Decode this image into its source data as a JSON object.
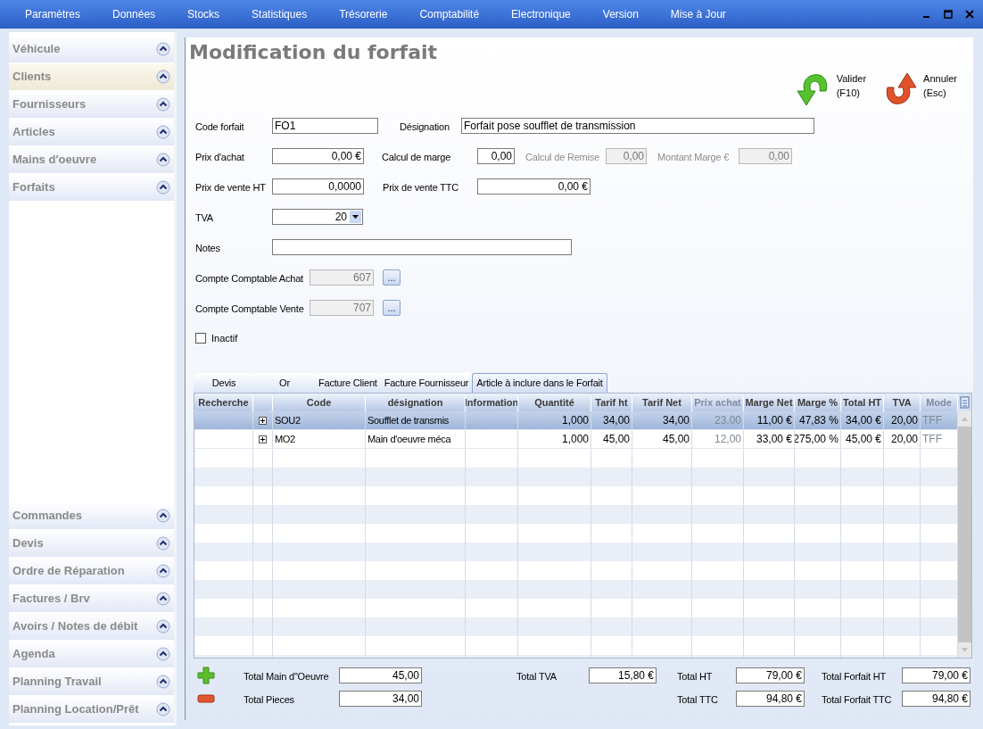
{
  "menu": [
    {
      "label": "Paramètres"
    },
    {
      "label": "Données"
    },
    {
      "label": "Stocks"
    },
    {
      "label": "Statistiques"
    },
    {
      "label": "Trésorerie"
    },
    {
      "label": "Comptabilité"
    },
    {
      "label": "Electronique"
    },
    {
      "label": "Version"
    },
    {
      "label": "Mise à Jour"
    }
  ],
  "sidebar": {
    "top": [
      {
        "label": "Véhicule",
        "selected": false
      },
      {
        "label": "Clients",
        "selected": true
      },
      {
        "label": "Fournisseurs",
        "selected": false
      },
      {
        "label": "Articles",
        "selected": false
      },
      {
        "label": "Mains d'oeuvre",
        "selected": false
      },
      {
        "label": "Forfaits",
        "selected": false
      }
    ],
    "bottom": [
      {
        "label": "Commandes",
        "selected": false
      },
      {
        "label": "Devis",
        "selected": false
      },
      {
        "label": "Ordre de Réparation",
        "selected": false
      },
      {
        "label": "Factures / Brv",
        "selected": false
      },
      {
        "label": "Avoirs / Notes de débit",
        "selected": false
      },
      {
        "label": "Agenda",
        "selected": false
      },
      {
        "label": "Planning Travail",
        "selected": false
      },
      {
        "label": "Planning Location/Prêt",
        "selected": false
      }
    ]
  },
  "title": "Modification du forfait",
  "actions": [
    {
      "kind": "ok",
      "label": "Valider",
      "key": "(F10)"
    },
    {
      "kind": "cancel",
      "label": "Annuler",
      "key": "(Esc)"
    }
  ],
  "form": [
    [
      {
        "kind": "label",
        "text": "Code forfait",
        "disabled": false
      },
      {
        "kind": "text_input",
        "value": "FO1",
        "disabled": false
      },
      {
        "kind": "label",
        "text": "Désignation",
        "disabled": false
      },
      {
        "kind": "text_input",
        "value": "Forfait pose soufflet de transmission",
        "disabled": false
      }
    ],
    [
      {
        "kind": "label",
        "text": "Prix d'achat",
        "disabled": false
      },
      {
        "kind": "number_input",
        "value": "0,00 €",
        "disabled": false
      },
      {
        "kind": "label",
        "text": "Calcul de marge",
        "disabled": false
      },
      {
        "kind": "number_input",
        "value": "0,00",
        "disabled": false
      },
      {
        "kind": "label",
        "text": "Calcul de Remise",
        "disabled": true
      },
      {
        "kind": "number_input",
        "value": "0,00",
        "disabled": true
      },
      {
        "kind": "label",
        "text": "Montant Marge €",
        "disabled": true
      },
      {
        "kind": "number_input",
        "value": "0,00",
        "disabled": true
      }
    ],
    [
      {
        "kind": "label",
        "text": "Prix de vente HT",
        "disabled": false
      },
      {
        "kind": "number_input",
        "value": "0,0000",
        "disabled": false
      },
      {
        "kind": "label",
        "text": "Prix de vente TTC",
        "disabled": false
      },
      {
        "kind": "number_input",
        "value": "0,00 €",
        "disabled": false
      }
    ],
    [
      {
        "kind": "label",
        "text": "TVA",
        "disabled": false
      },
      {
        "kind": "select",
        "value": "20"
      }
    ],
    [
      {
        "kind": "label",
        "text": "Notes",
        "disabled": false
      },
      {
        "kind": "text_input",
        "disabled": false
      }
    ],
    [
      {
        "kind": "label",
        "text": "Compte Comptable Achat",
        "disabled": false
      },
      {
        "kind": "number_input",
        "value": "607",
        "disabled": true
      },
      {
        "kind": "browse",
        "text": "..."
      }
    ],
    [
      {
        "kind": "label",
        "text": "Compte Comptable Vente",
        "disabled": false
      },
      {
        "kind": "number_input",
        "value": "707",
        "disabled": true
      },
      {
        "kind": "browse",
        "text": "..."
      }
    ],
    [
      {
        "kind": "checkbox",
        "label": "Inactif",
        "checked": false
      }
    ]
  ],
  "tabs": [
    {
      "label": "Devis",
      "selected": false
    },
    {
      "label": "Or",
      "selected": false
    },
    {
      "label": "Facture Client",
      "selected": false
    },
    {
      "label": "Facture Fournisseur",
      "selected": false
    },
    {
      "label": "Article à inclure dans le Forfait",
      "selected": true
    }
  ],
  "table": {
    "columns": [
      {
        "label": "Recherche",
        "disabled": false
      },
      {
        "label": "Code",
        "disabled": false
      },
      {
        "label": "désignation",
        "disabled": false
      },
      {
        "label": "Information",
        "disabled": false
      },
      {
        "label": "Quantité",
        "disabled": false
      },
      {
        "label": "Tarif ht",
        "disabled": false
      },
      {
        "label": "Tarif Net",
        "disabled": false
      },
      {
        "label": "Prix achat",
        "disabled": true
      },
      {
        "label": "Marge Net",
        "disabled": false
      },
      {
        "label": "Marge %",
        "disabled": false
      },
      {
        "label": "Total HT",
        "disabled": false
      },
      {
        "label": "TVA",
        "disabled": false
      },
      {
        "label": "Mode",
        "disabled": true
      }
    ],
    "rows": [
      {
        "selected": true,
        "expanded": false,
        "code": "SOU2",
        "designation": "Soufflet de transmis",
        "quantity": "1,000",
        "tarif_ht": "34,00",
        "tarif_net": "34,00",
        "prix_achat": "23,00",
        "marge_net": "11,00 €",
        "marge_pct": "47,83 %",
        "total_ht": "34,00 €",
        "tva": "20,00",
        "mode": "TFF"
      },
      {
        "selected": false,
        "expanded": false,
        "code": "MO2",
        "designation": "Main d'oeuvre méca",
        "quantity": "1,000",
        "tarif_ht": "45,00",
        "tarif_net": "45,00",
        "prix_achat": "12,00",
        "marge_net": "33,00 €",
        "marge_pct": "275,00 %",
        "total_ht": "45,00 €",
        "tva": "20,00",
        "mode": "TFF"
      }
    ]
  },
  "totals": [
    [
      {
        "label": "Total Main d\"Oeuvre",
        "value": "45,00"
      },
      {
        "label": "Total Pieces",
        "value": "34,00"
      }
    ],
    [
      {
        "label": "Total TVA",
        "value": "15,80 €"
      }
    ],
    [
      {
        "label": "Total HT",
        "value": "79,00 €"
      },
      {
        "label": "Total TTC",
        "value": "94,80 €"
      }
    ],
    [
      {
        "label": "Total Forfait HT",
        "value": "79,00 €"
      },
      {
        "label": "Total Forfait TTC",
        "value": "94,80 €"
      }
    ]
  ]
}
